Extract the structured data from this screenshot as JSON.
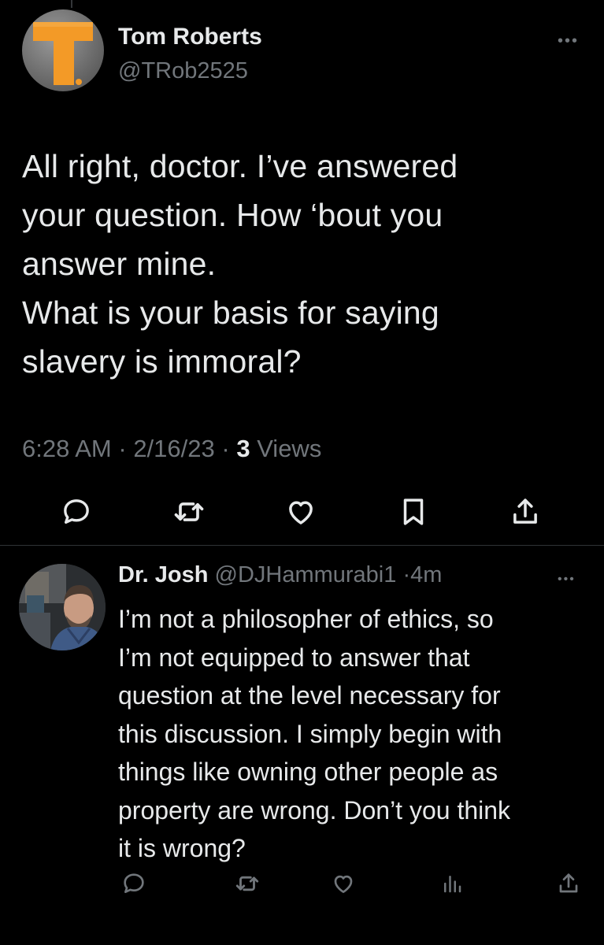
{
  "main_tweet": {
    "author_name": "Tom Roberts",
    "author_handle": "@TRob2525",
    "text": "All right, doctor. I’ve answered\nyour question.  How ‘bout you\nanswer mine.\nWhat is your basis for saying\nslavery is immoral?",
    "time": "6:28 AM",
    "date": "2/16/23",
    "views_count": "3",
    "views_label": "Views",
    "more_icon": "more-horizontal-icon",
    "actions": [
      "reply-icon",
      "retweet-icon",
      "like-icon",
      "bookmark-icon",
      "share-icon"
    ]
  },
  "reply_tweet": {
    "author_name": "Dr. Josh",
    "author_handle": "@DJHammurabi1",
    "time_ago": "4m",
    "text": "I’m not a philosopher of ethics, so\nI’m not equipped to answer that\nquestion at the level necessary for\nthis discussion. I simply begin with\nthings like owning other people as\nproperty are wrong. Don’t you think\nit is wrong?",
    "more_icon": "more-horizontal-icon",
    "actions": [
      "reply-icon",
      "retweet-icon",
      "like-icon",
      "analytics-icon",
      "share-icon"
    ]
  },
  "colors": {
    "background": "#000000",
    "text_primary": "#e7e9ea",
    "text_secondary": "#71767b",
    "divider": "#2f3336",
    "avatar_logo_orange": "#f39a27"
  }
}
